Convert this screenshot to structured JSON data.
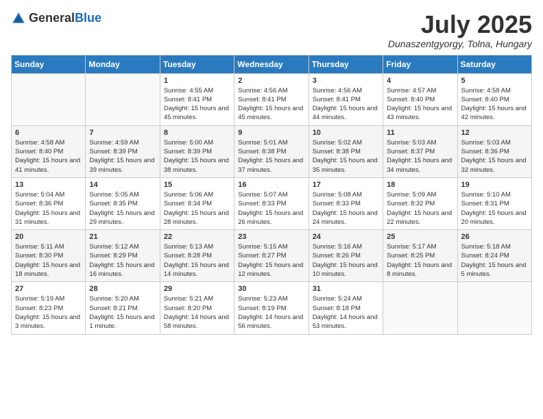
{
  "header": {
    "logo_general": "General",
    "logo_blue": "Blue",
    "title": "July 2025",
    "subtitle": "Dunaszentgyorgy, Tolna, Hungary"
  },
  "weekdays": [
    "Sunday",
    "Monday",
    "Tuesday",
    "Wednesday",
    "Thursday",
    "Friday",
    "Saturday"
  ],
  "weeks": [
    [
      {
        "day": "",
        "info": ""
      },
      {
        "day": "",
        "info": ""
      },
      {
        "day": "1",
        "info": "Sunrise: 4:55 AM\nSunset: 8:41 PM\nDaylight: 15 hours and 45 minutes."
      },
      {
        "day": "2",
        "info": "Sunrise: 4:56 AM\nSunset: 8:41 PM\nDaylight: 15 hours and 45 minutes."
      },
      {
        "day": "3",
        "info": "Sunrise: 4:56 AM\nSunset: 8:41 PM\nDaylight: 15 hours and 44 minutes."
      },
      {
        "day": "4",
        "info": "Sunrise: 4:57 AM\nSunset: 8:40 PM\nDaylight: 15 hours and 43 minutes."
      },
      {
        "day": "5",
        "info": "Sunrise: 4:58 AM\nSunset: 8:40 PM\nDaylight: 15 hours and 42 minutes."
      }
    ],
    [
      {
        "day": "6",
        "info": "Sunrise: 4:58 AM\nSunset: 8:40 PM\nDaylight: 15 hours and 41 minutes."
      },
      {
        "day": "7",
        "info": "Sunrise: 4:59 AM\nSunset: 8:39 PM\nDaylight: 15 hours and 39 minutes."
      },
      {
        "day": "8",
        "info": "Sunrise: 5:00 AM\nSunset: 8:39 PM\nDaylight: 15 hours and 38 minutes."
      },
      {
        "day": "9",
        "info": "Sunrise: 5:01 AM\nSunset: 8:38 PM\nDaylight: 15 hours and 37 minutes."
      },
      {
        "day": "10",
        "info": "Sunrise: 5:02 AM\nSunset: 8:38 PM\nDaylight: 15 hours and 35 minutes."
      },
      {
        "day": "11",
        "info": "Sunrise: 5:03 AM\nSunset: 8:37 PM\nDaylight: 15 hours and 34 minutes."
      },
      {
        "day": "12",
        "info": "Sunrise: 5:03 AM\nSunset: 8:36 PM\nDaylight: 15 hours and 32 minutes."
      }
    ],
    [
      {
        "day": "13",
        "info": "Sunrise: 5:04 AM\nSunset: 8:36 PM\nDaylight: 15 hours and 31 minutes."
      },
      {
        "day": "14",
        "info": "Sunrise: 5:05 AM\nSunset: 8:35 PM\nDaylight: 15 hours and 29 minutes."
      },
      {
        "day": "15",
        "info": "Sunrise: 5:06 AM\nSunset: 8:34 PM\nDaylight: 15 hours and 28 minutes."
      },
      {
        "day": "16",
        "info": "Sunrise: 5:07 AM\nSunset: 8:33 PM\nDaylight: 15 hours and 26 minutes."
      },
      {
        "day": "17",
        "info": "Sunrise: 5:08 AM\nSunset: 8:33 PM\nDaylight: 15 hours and 24 minutes."
      },
      {
        "day": "18",
        "info": "Sunrise: 5:09 AM\nSunset: 8:32 PM\nDaylight: 15 hours and 22 minutes."
      },
      {
        "day": "19",
        "info": "Sunrise: 5:10 AM\nSunset: 8:31 PM\nDaylight: 15 hours and 20 minutes."
      }
    ],
    [
      {
        "day": "20",
        "info": "Sunrise: 5:11 AM\nSunset: 8:30 PM\nDaylight: 15 hours and 18 minutes."
      },
      {
        "day": "21",
        "info": "Sunrise: 5:12 AM\nSunset: 8:29 PM\nDaylight: 15 hours and 16 minutes."
      },
      {
        "day": "22",
        "info": "Sunrise: 5:13 AM\nSunset: 8:28 PM\nDaylight: 15 hours and 14 minutes."
      },
      {
        "day": "23",
        "info": "Sunrise: 5:15 AM\nSunset: 8:27 PM\nDaylight: 15 hours and 12 minutes."
      },
      {
        "day": "24",
        "info": "Sunrise: 5:16 AM\nSunset: 8:26 PM\nDaylight: 15 hours and 10 minutes."
      },
      {
        "day": "25",
        "info": "Sunrise: 5:17 AM\nSunset: 8:25 PM\nDaylight: 15 hours and 8 minutes."
      },
      {
        "day": "26",
        "info": "Sunrise: 5:18 AM\nSunset: 8:24 PM\nDaylight: 15 hours and 5 minutes."
      }
    ],
    [
      {
        "day": "27",
        "info": "Sunrise: 5:19 AM\nSunset: 8:23 PM\nDaylight: 15 hours and 3 minutes."
      },
      {
        "day": "28",
        "info": "Sunrise: 5:20 AM\nSunset: 8:21 PM\nDaylight: 15 hours and 1 minute."
      },
      {
        "day": "29",
        "info": "Sunrise: 5:21 AM\nSunset: 8:20 PM\nDaylight: 14 hours and 58 minutes."
      },
      {
        "day": "30",
        "info": "Sunrise: 5:23 AM\nSunset: 8:19 PM\nDaylight: 14 hours and 56 minutes."
      },
      {
        "day": "31",
        "info": "Sunrise: 5:24 AM\nSunset: 8:18 PM\nDaylight: 14 hours and 53 minutes."
      },
      {
        "day": "",
        "info": ""
      },
      {
        "day": "",
        "info": ""
      }
    ]
  ]
}
